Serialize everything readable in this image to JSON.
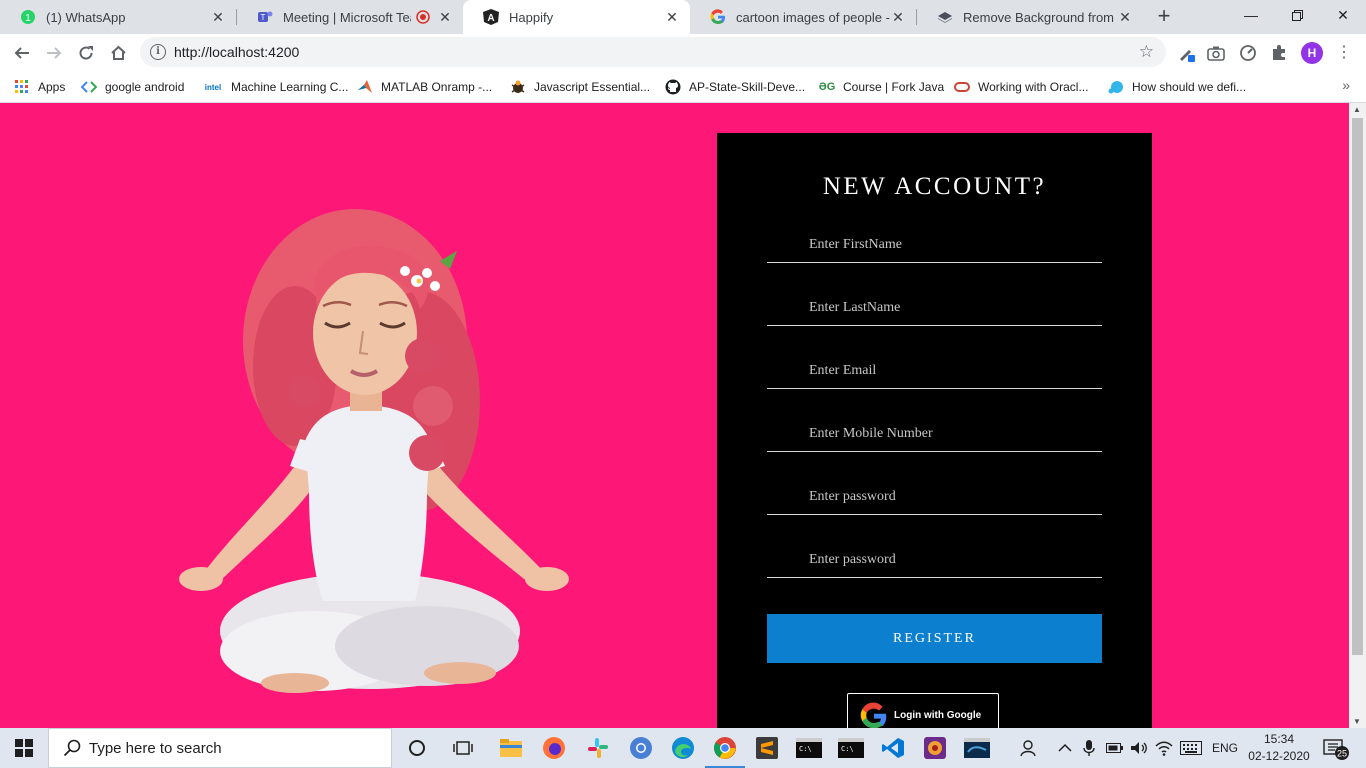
{
  "browser": {
    "tabs": [
      {
        "title": "(1) WhatsApp",
        "icon": "whatsapp-icon",
        "active": false
      },
      {
        "title": "Meeting | Microsoft Teams",
        "icon": "teams-icon",
        "active": false
      },
      {
        "title": "Happify",
        "icon": "angular-icon",
        "active": true
      },
      {
        "title": "cartoon images of people - Go",
        "icon": "google-icon",
        "active": false
      },
      {
        "title": "Remove Background from Ima",
        "icon": "remove-bg-icon",
        "active": false
      }
    ],
    "whatsapp_badge": "1",
    "url": "http://localhost:4200",
    "profile_initial": "H",
    "bookmarks": [
      "Apps",
      "google android",
      "Machine Learning C...",
      "MATLAB Onramp -...",
      "Javascript Essential...",
      "AP-State-Skill-Deve...",
      "Course | Fork Java",
      "Working with Oracl...",
      "How should we defi..."
    ],
    "bookmark_icon_text": {
      "intel": "intel",
      "geeks": "ƏG"
    }
  },
  "page": {
    "title": "NEW ACCOUNT?",
    "fields": {
      "first_name": "Enter FirstName",
      "last_name": "Enter LastName",
      "email": "Enter Email",
      "mobile": "Enter Mobile Number",
      "password": "Enter password",
      "confirm_password": "Enter password"
    },
    "register_label": "REGISTER",
    "google_login_label": "Login with Google",
    "colors": {
      "background": "#fd1777",
      "panel": "#000000",
      "register": "#0d7fcf"
    }
  },
  "taskbar": {
    "search_placeholder": "Type here to search",
    "language": "ENG",
    "time": "15:34",
    "date": "02-12-2020",
    "notification_count": "25"
  }
}
